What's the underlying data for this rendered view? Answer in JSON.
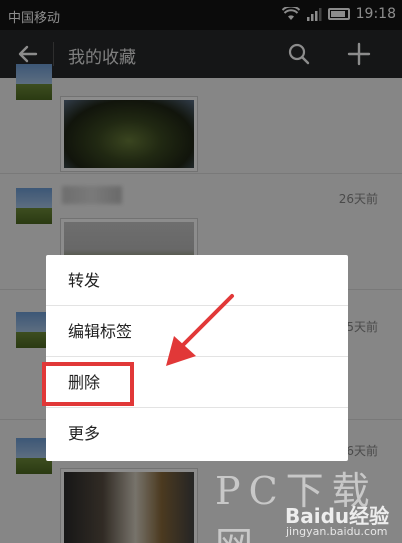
{
  "status_bar": {
    "carrier": "中国移动",
    "time": "19:18"
  },
  "action_bar": {
    "title": "我的收藏",
    "back_icon": "back-arrow-icon",
    "search_icon": "search-icon",
    "add_icon": "plus-icon"
  },
  "list": {
    "items": [
      {
        "time": ""
      },
      {
        "time": "26天前"
      },
      {
        "time": "25天前"
      },
      {
        "time": "26天前"
      }
    ]
  },
  "context_menu": {
    "items": [
      {
        "label": "转发"
      },
      {
        "label": "编辑标签"
      },
      {
        "label": "删除"
      },
      {
        "label": "更多"
      }
    ],
    "highlighted_item": "删除",
    "highlight_color": "#e13838"
  },
  "watermarks": {
    "site": "PC下载网",
    "baidu": "Baidu经验",
    "url": "jingyan.baidu.com"
  }
}
